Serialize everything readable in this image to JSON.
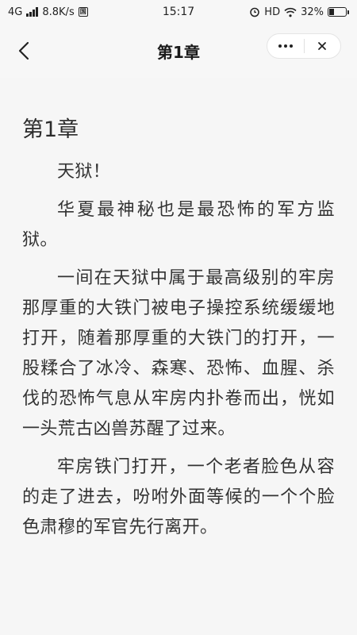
{
  "status_bar": {
    "network": "4G",
    "speed": "8.8K/s",
    "time": "15:17",
    "hd": "HD",
    "battery_text": "32%",
    "battery_level": 0.32
  },
  "header": {
    "title": "第1章"
  },
  "chapter": {
    "title": "第1章",
    "paragraphs": [
      "天狱！",
      "华夏最神秘也是最恐怖的军方监狱。",
      "一间在天狱中属于最高级别的牢房那厚重的大铁门被电子操控系统缓缓地打开，随着那厚重的大铁门的打开，一股糅合了冰冷、森寒、恐怖、血腥、杀伐的恐怖气息从牢房内扑卷而出，恍如一头荒古凶兽苏醒了过来。",
      "牢房铁门打开，一个老者脸色从容的走了进去，吩咐外面等候的一个个脸色肃穆的军官先行离开。"
    ]
  }
}
